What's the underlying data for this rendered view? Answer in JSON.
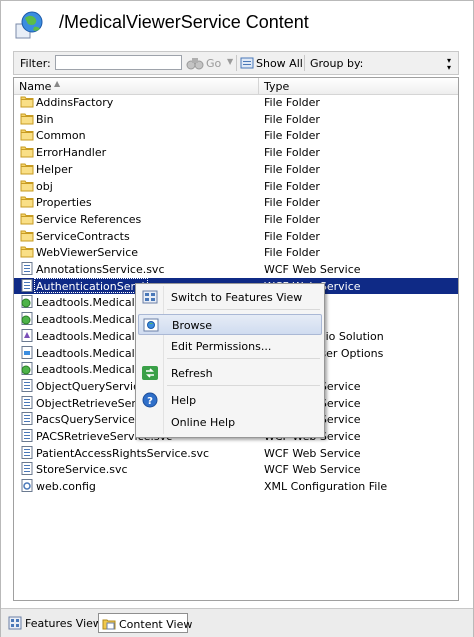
{
  "header": {
    "title": "/MedicalViewerService Content"
  },
  "toolbar": {
    "filter_label": "Filter:",
    "filter_value": "",
    "go_label": "Go",
    "show_all_label": "Show All",
    "group_by_label": "Group by:"
  },
  "columns": {
    "name": "Name",
    "type": "Type"
  },
  "rows": [
    {
      "name": "AddinsFactory",
      "type": "File Folder",
      "icon": "folder-icon"
    },
    {
      "name": "Bin",
      "type": "File Folder",
      "icon": "folder-icon"
    },
    {
      "name": "Common",
      "type": "File Folder",
      "icon": "folder-icon"
    },
    {
      "name": "ErrorHandler",
      "type": "File Folder",
      "icon": "folder-icon"
    },
    {
      "name": "Helper",
      "type": "File Folder",
      "icon": "folder-icon"
    },
    {
      "name": "obj",
      "type": "File Folder",
      "icon": "folder-icon"
    },
    {
      "name": "Properties",
      "type": "File Folder",
      "icon": "folder-icon"
    },
    {
      "name": "Service References",
      "type": "File Folder",
      "icon": "folder-icon"
    },
    {
      "name": "ServiceContracts",
      "type": "File Folder",
      "icon": "folder-icon"
    },
    {
      "name": "WebViewerService",
      "type": "File Folder",
      "icon": "folder-icon"
    },
    {
      "name": "AnnotationsService.svc",
      "type": "WCF Web Service",
      "icon": "svc-file-icon"
    },
    {
      "name": "AuthenticationService.svc",
      "type": "WCF Web Service",
      "icon": "svc-file-icon",
      "selected": true
    },
    {
      "name": "Leadtools.Medical.We",
      "type": "Project file",
      "icon": "project-file-icon"
    },
    {
      "name": "Leadtools.Medical.We",
      "type": "Project file",
      "icon": "project-file-icon"
    },
    {
      "name": "Leadtools.Medical.We",
      "type": "Visual Studio Solution",
      "icon": "solution-file-icon"
    },
    {
      "name": "Leadtools.Medical.We",
      "type": "Solution User Options",
      "icon": "generic-file-icon"
    },
    {
      "name": "Leadtools.Medical.We",
      "type": "Project file",
      "icon": "project-file-icon"
    },
    {
      "name": "ObjectQueryService.s",
      "type": "WCF Web Service",
      "icon": "svc-file-icon"
    },
    {
      "name": "ObjectRetrieveService",
      "type": "WCF Web Service",
      "icon": "svc-file-icon"
    },
    {
      "name": "PacsQueryService.svc",
      "type": "WCF Web Service",
      "icon": "svc-file-icon"
    },
    {
      "name": "PACSRetrieveService.svc",
      "type": "WCF Web Service",
      "icon": "svc-file-icon"
    },
    {
      "name": "PatientAccessRightsService.svc",
      "type": "WCF Web Service",
      "icon": "svc-file-icon"
    },
    {
      "name": "StoreService.svc",
      "type": "WCF Web Service",
      "icon": "svc-file-icon"
    },
    {
      "name": "web.config",
      "type": "XML Configuration File",
      "icon": "config-file-icon"
    }
  ],
  "context_menu": {
    "items": [
      {
        "label": "Switch to Features View",
        "icon": "features-view-icon"
      },
      {
        "label": "Browse",
        "icon": "browse-icon",
        "highlighted": true
      },
      {
        "label": "Edit Permissions...",
        "icon": ""
      },
      {
        "label": "Refresh",
        "icon": "refresh-icon"
      },
      {
        "label": "Help",
        "icon": "help-icon"
      },
      {
        "label": "Online Help",
        "icon": ""
      }
    ]
  },
  "bottom_tabs": [
    {
      "label": "Features View",
      "active": false
    },
    {
      "label": "Content View",
      "active": true
    }
  ],
  "colors": {
    "selection": "#0f2a86",
    "folder": "#f2c94c",
    "menu_highlight": "#d0dcf0"
  }
}
